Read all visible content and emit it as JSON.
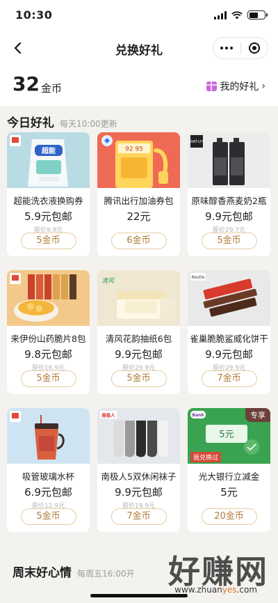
{
  "status_bar": {
    "time": "10:30"
  },
  "nav": {
    "title": "兑换好礼"
  },
  "header": {
    "coins": "32",
    "coin_unit": "金币",
    "my_gift": "我的好礼",
    "chevron": "›"
  },
  "today": {
    "title": "今日好礼",
    "subtitle": "每天10:00更新"
  },
  "items": [
    {
      "name": "超能洗衣液换购券",
      "price": "5.9元包邮",
      "orig": "原价9.9元",
      "coins": "5金币",
      "badge_text": "超能",
      "thumb_bg": "#b9dbe4"
    },
    {
      "name": "腾讯出行加油券包",
      "price": "22元",
      "orig": "",
      "coins": "6金币",
      "badge_text": "92  95",
      "thumb_bg": "#ef6a54"
    },
    {
      "name": "原味醇香燕麦奶2瓶",
      "price": "9.9元包邮",
      "orig": "原价29.7元",
      "coins": "5金币",
      "badge_text": "OAT-LY!",
      "thumb_bg": "#ececec"
    },
    {
      "name": "来伊份山药脆片8包",
      "price": "9.8元包邮",
      "orig": "原价16.9元",
      "coins": "5金币",
      "badge_text": "",
      "thumb_bg": "#f3c98b"
    },
    {
      "name": "清风花韵抽纸6包",
      "price": "9.9元包邮",
      "orig": "原价29.9元",
      "coins": "5金币",
      "badge_text": "清风",
      "thumb_bg": "#efe7d2"
    },
    {
      "name": "雀巢脆脆鲨威化饼干",
      "price": "9.9元包邮",
      "orig": "原价29.9元",
      "coins": "7金币",
      "badge_text": "Nestle",
      "thumb_bg": "#e9e9e9"
    },
    {
      "name": "吸管玻璃水杯",
      "price": "6.9元包邮",
      "orig": "原价12.9元",
      "coins": "5金币",
      "badge_text": "",
      "thumb_bg": "#cfe4f3"
    },
    {
      "name": "南极人5双休闲袜子",
      "price": "9.9元包邮",
      "orig": "原价19.9元",
      "coins": "7金币",
      "badge_text": "南极人",
      "thumb_bg": "#e4e7eb"
    },
    {
      "name": "光大银行立减金",
      "price": "5元",
      "orig": "",
      "coins": "20金币",
      "badge_text": "5元",
      "thumb_bg": "#39a351",
      "tag": "专享",
      "redeemed": "我兑换过",
      "bank_tag": "Bank"
    }
  ],
  "weekend": {
    "title": "周末好心情",
    "subtitle": "每周五16:00开"
  },
  "watermark": {
    "big": "好赚网",
    "small_a": "www.zhuan",
    "small_b": "yes",
    "small_c": ".com"
  },
  "colors": {
    "accent": "#b07c3a",
    "bg": "#f4f2ef"
  }
}
